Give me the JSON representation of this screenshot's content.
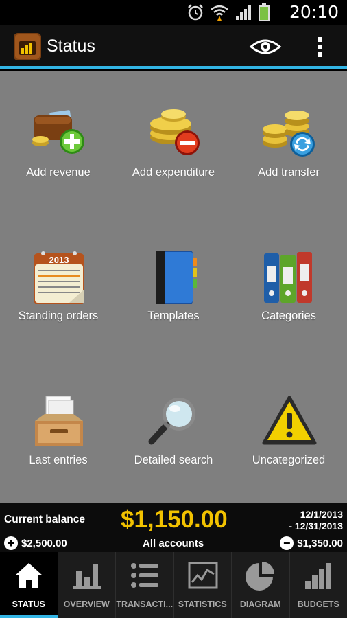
{
  "status_bar": {
    "time": "20:10"
  },
  "action_bar": {
    "title": "Status"
  },
  "tiles": [
    {
      "label": "Add revenue",
      "icon": "wallet-plus-icon"
    },
    {
      "label": "Add expenditure",
      "icon": "coins-minus-icon"
    },
    {
      "label": "Add transfer",
      "icon": "coins-transfer-icon"
    },
    {
      "label": "Standing orders",
      "icon": "calendar-icon",
      "calendar_year": "2013"
    },
    {
      "label": "Templates",
      "icon": "notebook-icon"
    },
    {
      "label": "Categories",
      "icon": "binders-icon"
    },
    {
      "label": "Last entries",
      "icon": "inbox-tray-icon"
    },
    {
      "label": "Detailed search",
      "icon": "magnifier-icon"
    },
    {
      "label": "Uncategorized",
      "icon": "warning-icon"
    }
  ],
  "balance": {
    "label": "Current balance",
    "amount": "$1,150.00",
    "date_from": "12/1/2013",
    "date_to": "- 12/31/2013",
    "accounts": "All accounts",
    "income": "$2,500.00",
    "expense": "$1,350.00"
  },
  "tabs": [
    {
      "label": "STATUS",
      "icon": "home-icon",
      "active": true
    },
    {
      "label": "OVERVIEW",
      "icon": "bar-chart-icon",
      "active": false
    },
    {
      "label": "TRANSACTI...",
      "icon": "list-icon",
      "active": false
    },
    {
      "label": "STATISTICS",
      "icon": "line-chart-icon",
      "active": false
    },
    {
      "label": "DIAGRAM",
      "icon": "pie-chart-icon",
      "active": false
    },
    {
      "label": "BUDGETS",
      "icon": "ascending-bars-icon",
      "active": false
    }
  ],
  "colors": {
    "accent": "#33b5e5",
    "balance": "#f2c200",
    "panel": "#7f7f7f"
  }
}
